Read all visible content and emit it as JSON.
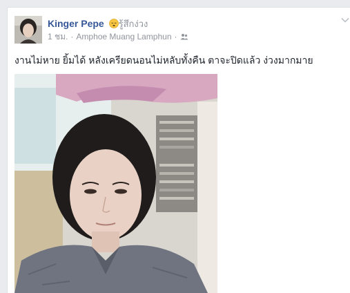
{
  "post": {
    "author": "Kinger Pepe",
    "feeling": "รู้สึกง่วง",
    "time": "1 ชม.",
    "location": "Amphoe Muang Lamphun",
    "audience_icon": "friends-icon",
    "text": "งานไม่หาย ยิ้มได้ หลังเครียดนอนไม่หลับทั้งคืน ตาจะปิดแล้ว ง่วงมากมาย"
  },
  "colors": {
    "author_link": "#365899",
    "meta_text": "#90949c",
    "body_text": "#1d2129"
  }
}
